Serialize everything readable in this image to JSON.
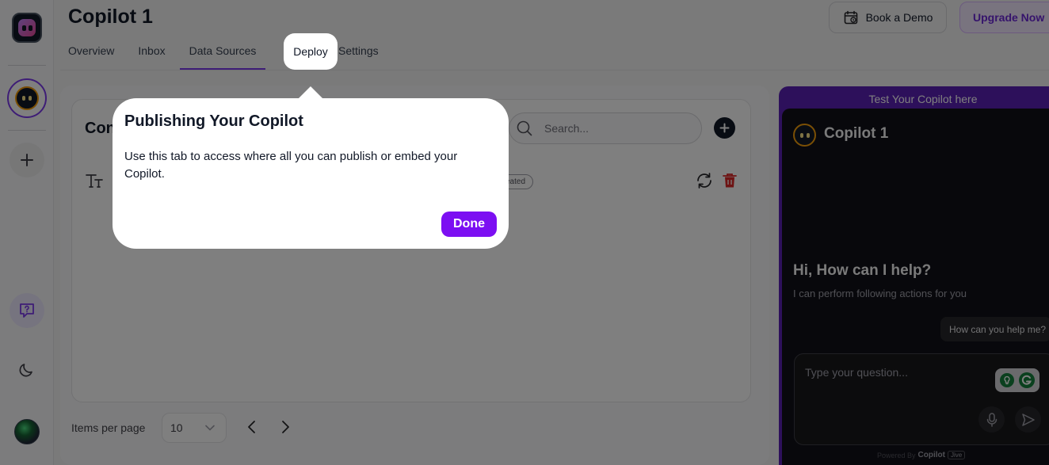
{
  "app": {
    "title": "Copilot 1"
  },
  "header": {
    "tabs": [
      {
        "label": "Overview"
      },
      {
        "label": "Inbox"
      },
      {
        "label": "Data Sources",
        "active": true
      },
      {
        "label": "Deploy",
        "highlighted": true
      },
      {
        "label": "Settings"
      }
    ],
    "book_demo_label": "Book a Demo",
    "upgrade_label": "Upgrade Now"
  },
  "sidebar": {
    "logo_icon": "copilot-logo-icon",
    "items": [
      {
        "name": "copilot-avatar",
        "icon": "robot-face-icon"
      },
      {
        "name": "add-copilot",
        "icon": "plus-icon"
      },
      {
        "name": "help",
        "icon": "chat-question-icon"
      },
      {
        "name": "theme-toggle",
        "icon": "moon-icon"
      },
      {
        "name": "user-profile",
        "icon": "user-avatar"
      }
    ]
  },
  "main": {
    "card_title_visible": "Con",
    "search": {
      "placeholder": "Search..."
    },
    "row": {
      "icon": "text-icon",
      "badge": "eated"
    },
    "pagination": {
      "items_per_page_label": "Items per page",
      "items_per_page_value": "10"
    }
  },
  "preview": {
    "header_label": "Test Your Copilot here",
    "copilot_name": "Copilot 1",
    "greeting": "Hi, How can I help?",
    "subtext": "I can perform following actions for you",
    "suggestion_chip": "How can you help me?",
    "input_placeholder": "Type your question...",
    "powered_by": "Powered By",
    "powered_brand": "Copilot",
    "powered_tag": "Jive"
  },
  "popover": {
    "title": "Publishing Your Copilot",
    "body": "Use this tab to access where all you can publish or embed your Copilot.",
    "done_label": "Done"
  },
  "colors": {
    "accent": "#7c3aed",
    "done_button": "#7c0ff2",
    "preview_border": "#5b21b6",
    "preview_bg": "#111119",
    "trash": "#dc2626"
  }
}
